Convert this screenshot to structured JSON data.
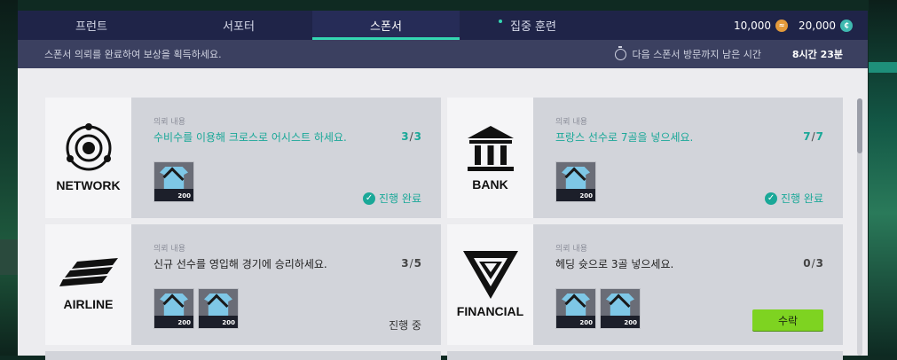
{
  "tabs": [
    {
      "label": "프런트",
      "active": false,
      "dot": false
    },
    {
      "label": "서포터",
      "active": false,
      "dot": false
    },
    {
      "label": "스폰서",
      "active": true,
      "dot": false
    },
    {
      "label": "집중 훈련",
      "active": false,
      "dot": true
    }
  ],
  "currency": {
    "coins": {
      "value": "10,000",
      "icon": "coin-icon"
    },
    "points": {
      "value": "20,000",
      "icon": "token-icon"
    }
  },
  "subbar": {
    "description": "스폰서 의뢰를 완료하여 보상을 획득하세요.",
    "timer_label": "다음 스폰서 방문까지 남은 시간",
    "timer_value": "8시간 23분"
  },
  "cards": [
    {
      "sponsor": "NETWORK",
      "label": "의뢰 내용",
      "mission": "수비수를 이용해 크로스로 어시스트 하세요.",
      "progress_current": "3",
      "progress_total": "3",
      "completed": true,
      "status": "진행 완료",
      "rewards": [
        "200"
      ]
    },
    {
      "sponsor": "BANK",
      "label": "의뢰 내용",
      "mission": "프랑스 선수로 7골을 넣으세요.",
      "progress_current": "7",
      "progress_total": "7",
      "completed": true,
      "status": "진행 완료",
      "rewards": [
        "200"
      ]
    },
    {
      "sponsor": "AIRLINE",
      "label": "의뢰 내용",
      "mission": "신규 선수를 영입해 경기에 승리하세요.",
      "progress_current": "3",
      "progress_total": "5",
      "completed": false,
      "status": "진행 중",
      "rewards": [
        "200",
        "200"
      ]
    },
    {
      "sponsor": "FINANCIAL",
      "label": "의뢰 내용",
      "mission": "헤딩 슛으로 3골 넣으세요.",
      "progress_current": "0",
      "progress_total": "3",
      "completed": false,
      "action": "수락",
      "rewards": [
        "200",
        "200"
      ]
    }
  ],
  "colors": {
    "accent": "#34d6b2",
    "complete": "#1aa898",
    "accept_button": "#7ed321",
    "topbar": "#1f2448"
  }
}
